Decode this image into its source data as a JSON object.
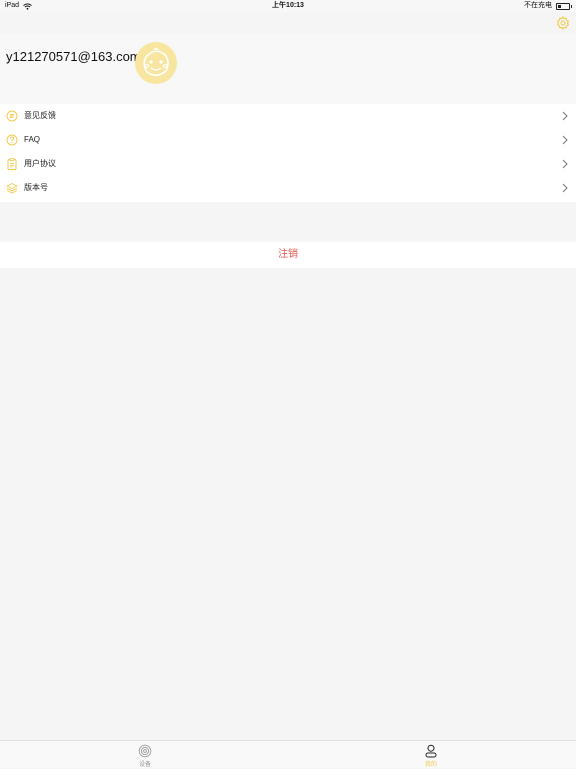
{
  "status_bar": {
    "device": "iPad",
    "time": "上午10:13",
    "charging": "不在充电"
  },
  "profile": {
    "email": "y121270571@163.com"
  },
  "menu": {
    "items": [
      {
        "label": "意见反馈",
        "icon": "feedback-icon"
      },
      {
        "label": "FAQ",
        "icon": "question-icon"
      },
      {
        "label": "用户协议",
        "icon": "clipboard-icon"
      },
      {
        "label": "版本号",
        "icon": "layers-icon"
      }
    ]
  },
  "logout_label": "注销",
  "tabs": [
    {
      "label": "设备",
      "icon": "device-icon",
      "active": false
    },
    {
      "label": "我的",
      "icon": "user-icon",
      "active": true
    }
  ],
  "colors": {
    "accent": "#f2c94c",
    "accent_light": "#f8e6a0",
    "danger": "#e8554e",
    "inactive": "#9a9a9a"
  }
}
